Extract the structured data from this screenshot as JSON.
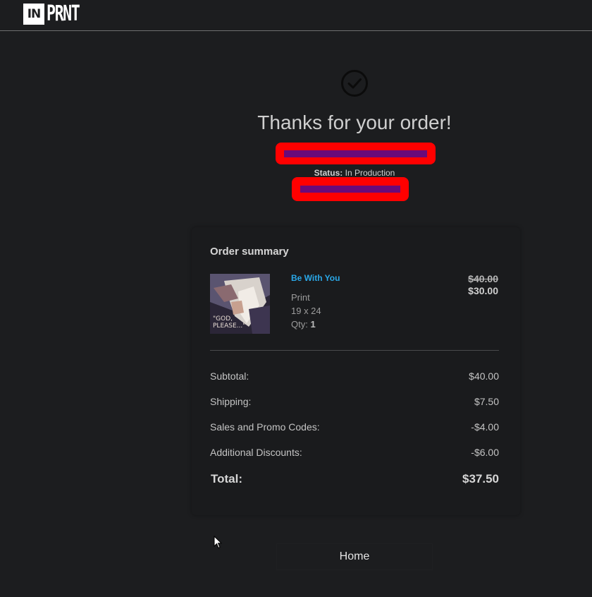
{
  "header": {
    "logo_box": "IN",
    "logo_text": "PRNT"
  },
  "confirmation": {
    "icon": "check-circle-icon",
    "title": "Thanks for your order!",
    "status_label": "Status:",
    "status_value": "In Production"
  },
  "summary": {
    "title": "Order summary",
    "item": {
      "name": "Be With You",
      "type": "Print",
      "size": "19 x 24",
      "qty_label": "Qty:",
      "qty_value": "1",
      "thumbnail_text": "\"GOD, PLEASE...\"",
      "price_original": "$40.00",
      "price_sale": "$30.00"
    },
    "rows": [
      {
        "label": "Subtotal:",
        "value": "$40.00"
      },
      {
        "label": "Shipping:",
        "value": "$7.50"
      },
      {
        "label": "Sales and Promo Codes:",
        "value": "-$4.00"
      },
      {
        "label": "Additional Discounts:",
        "value": "-$6.00"
      }
    ],
    "total_label": "Total:",
    "total_value": "$37.50"
  },
  "footer": {
    "home_label": "Home"
  },
  "colors": {
    "background": "#1c1d1f",
    "link": "#2aa8e8",
    "redaction": "#ff0000"
  }
}
